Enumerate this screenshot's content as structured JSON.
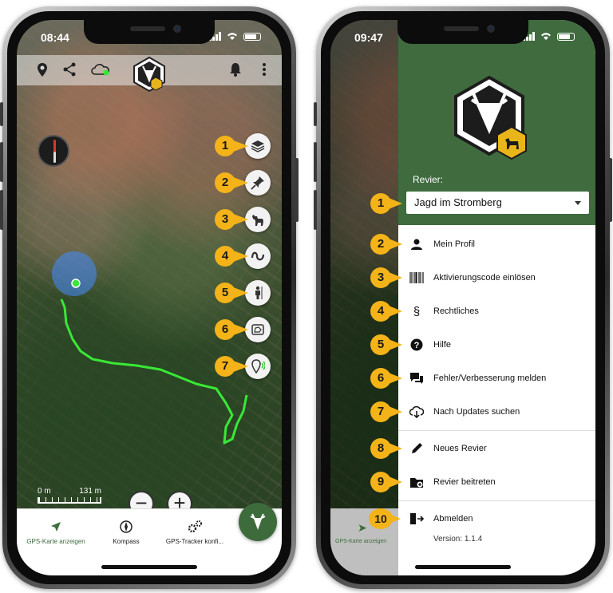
{
  "left_phone": {
    "status_time": "08:44",
    "map_scale": {
      "start": "0 m",
      "end": "131 m"
    },
    "zoom_out": "−",
    "zoom_in": "+",
    "callouts": [
      "1",
      "2",
      "3",
      "4",
      "5",
      "6",
      "7"
    ],
    "map_buttons": [
      "layers-icon",
      "pin-icon",
      "dog-icon",
      "track-icon",
      "hunter-icon",
      "map-area-icon",
      "gps-signal-icon"
    ],
    "bottom_nav": [
      {
        "label": "GPS-Karte anzeigen",
        "icon": "navigation-arrow-icon",
        "active": true
      },
      {
        "label": "Kompass",
        "icon": "compass-icon",
        "active": false
      },
      {
        "label": "GPS-Tracker konfi...",
        "icon": "gears-icon",
        "active": false
      }
    ]
  },
  "right_phone": {
    "status_time": "09:47",
    "revier_label": "Revier:",
    "revier_value": "Jagd im Stromberg",
    "menu": [
      {
        "num": "2",
        "label": "Mein Profil",
        "icon": "person-icon"
      },
      {
        "num": "3",
        "label": "Aktivierungscode einlösen",
        "icon": "barcode-icon"
      },
      {
        "num": "4",
        "label": "Rechtliches",
        "icon": "paragraph-icon"
      },
      {
        "num": "5",
        "label": "Hilfe",
        "icon": "help-icon"
      },
      {
        "num": "6",
        "label": "Fehler/Verbesserung melden",
        "icon": "feedback-icon"
      },
      {
        "num": "7",
        "label": "Nach Updates suchen",
        "icon": "cloud-download-icon"
      },
      {
        "num": "8",
        "label": "Neues Revier",
        "icon": "pencil-icon"
      },
      {
        "num": "9",
        "label": "Revier beitreten",
        "icon": "folder-add-icon"
      },
      {
        "num": "10",
        "label": "Abmelden",
        "icon": "logout-icon"
      }
    ],
    "select_callout": "1",
    "version": "Version: 1.1.4",
    "background_nav_label": "GPS-Karte anzeigen"
  },
  "colors": {
    "accent_green": "#3f6b3e",
    "callout_yellow": "#f4b318",
    "track_green": "#39e836"
  }
}
